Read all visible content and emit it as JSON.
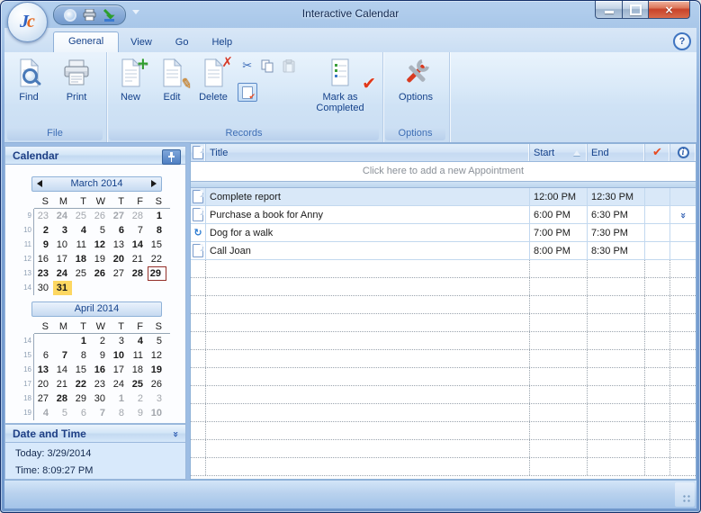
{
  "titlebar": {
    "title": "Interactive Calendar"
  },
  "tabs": [
    {
      "label": "General",
      "active": true
    },
    {
      "label": "View",
      "active": false
    },
    {
      "label": "Go",
      "active": false
    },
    {
      "label": "Help",
      "active": false
    }
  ],
  "ribbon": {
    "groups": [
      {
        "caption": "File"
      },
      {
        "caption": "Records"
      },
      {
        "caption": "Options"
      }
    ],
    "buttons": {
      "find": "Find",
      "print": "Print",
      "new": "New",
      "edit": "Edit",
      "delete": "Delete",
      "mark": "Mark as Completed",
      "options": "Options"
    }
  },
  "sidebar": {
    "calendar_header": "Calendar",
    "months": [
      {
        "label": "March 2014",
        "nav_arrows": true,
        "weekdays": [
          "S",
          "M",
          "T",
          "W",
          "T",
          "F",
          "S"
        ],
        "weeks": [
          {
            "n": "9",
            "d": [
              {
                "t": "23",
                "f": "g"
              },
              {
                "t": "24",
                "f": "g b"
              },
              {
                "t": "25",
                "f": "g"
              },
              {
                "t": "26",
                "f": "g"
              },
              {
                "t": "27",
                "f": "g b"
              },
              {
                "t": "28",
                "f": "g"
              },
              {
                "t": "1",
                "f": "b"
              }
            ]
          },
          {
            "n": "10",
            "d": [
              {
                "t": "2",
                "f": "b"
              },
              {
                "t": "3",
                "f": "b"
              },
              {
                "t": "4",
                "f": "b"
              },
              {
                "t": "5",
                "f": ""
              },
              {
                "t": "6",
                "f": "b"
              },
              {
                "t": "7",
                "f": ""
              },
              {
                "t": "8",
                "f": "b"
              }
            ]
          },
          {
            "n": "11",
            "d": [
              {
                "t": "9",
                "f": "b"
              },
              {
                "t": "10",
                "f": ""
              },
              {
                "t": "11",
                "f": ""
              },
              {
                "t": "12",
                "f": "b"
              },
              {
                "t": "13",
                "f": ""
              },
              {
                "t": "14",
                "f": "b"
              },
              {
                "t": "15",
                "f": ""
              }
            ]
          },
          {
            "n": "12",
            "d": [
              {
                "t": "16",
                "f": ""
              },
              {
                "t": "17",
                "f": ""
              },
              {
                "t": "18",
                "f": "b"
              },
              {
                "t": "19",
                "f": ""
              },
              {
                "t": "20",
                "f": "b"
              },
              {
                "t": "21",
                "f": ""
              },
              {
                "t": "22",
                "f": ""
              }
            ]
          },
          {
            "n": "13",
            "d": [
              {
                "t": "23",
                "f": "b"
              },
              {
                "t": "24",
                "f": "b"
              },
              {
                "t": "25",
                "f": ""
              },
              {
                "t": "26",
                "f": "b"
              },
              {
                "t": "27",
                "f": ""
              },
              {
                "t": "28",
                "f": "b"
              },
              {
                "t": "29",
                "f": "b today"
              }
            ]
          },
          {
            "n": "14",
            "d": [
              {
                "t": "30",
                "f": ""
              },
              {
                "t": "31",
                "f": "b hl"
              },
              {
                "t": "",
                "f": ""
              },
              {
                "t": "",
                "f": ""
              },
              {
                "t": "",
                "f": ""
              },
              {
                "t": "",
                "f": ""
              },
              {
                "t": "",
                "f": ""
              }
            ]
          }
        ]
      },
      {
        "label": "April 2014",
        "nav_arrows": false,
        "weekdays": [
          "S",
          "M",
          "T",
          "W",
          "T",
          "F",
          "S"
        ],
        "weeks": [
          {
            "n": "14",
            "d": [
              {
                "t": "",
                "f": ""
              },
              {
                "t": "",
                "f": ""
              },
              {
                "t": "1",
                "f": "b"
              },
              {
                "t": "2",
                "f": ""
              },
              {
                "t": "3",
                "f": ""
              },
              {
                "t": "4",
                "f": "b"
              },
              {
                "t": "5",
                "f": ""
              }
            ]
          },
          {
            "n": "15",
            "d": [
              {
                "t": "6",
                "f": ""
              },
              {
                "t": "7",
                "f": "b"
              },
              {
                "t": "8",
                "f": ""
              },
              {
                "t": "9",
                "f": ""
              },
              {
                "t": "10",
                "f": "b"
              },
              {
                "t": "11",
                "f": ""
              },
              {
                "t": "12",
                "f": ""
              }
            ]
          },
          {
            "n": "16",
            "d": [
              {
                "t": "13",
                "f": "b"
              },
              {
                "t": "14",
                "f": ""
              },
              {
                "t": "15",
                "f": ""
              },
              {
                "t": "16",
                "f": "b"
              },
              {
                "t": "17",
                "f": ""
              },
              {
                "t": "18",
                "f": ""
              },
              {
                "t": "19",
                "f": "b"
              }
            ]
          },
          {
            "n": "17",
            "d": [
              {
                "t": "20",
                "f": ""
              },
              {
                "t": "21",
                "f": ""
              },
              {
                "t": "22",
                "f": "b"
              },
              {
                "t": "23",
                "f": ""
              },
              {
                "t": "24",
                "f": ""
              },
              {
                "t": "25",
                "f": "b"
              },
              {
                "t": "26",
                "f": ""
              }
            ]
          },
          {
            "n": "18",
            "d": [
              {
                "t": "27",
                "f": ""
              },
              {
                "t": "28",
                "f": "b"
              },
              {
                "t": "29",
                "f": ""
              },
              {
                "t": "30",
                "f": ""
              },
              {
                "t": "1",
                "f": "g b"
              },
              {
                "t": "2",
                "f": "g"
              },
              {
                "t": "3",
                "f": "g"
              }
            ]
          },
          {
            "n": "19",
            "d": [
              {
                "t": "4",
                "f": "g b"
              },
              {
                "t": "5",
                "f": "g"
              },
              {
                "t": "6",
                "f": "g"
              },
              {
                "t": "7",
                "f": "g b"
              },
              {
                "t": "8",
                "f": "g"
              },
              {
                "t": "9",
                "f": "g"
              },
              {
                "t": "10",
                "f": "g b"
              }
            ]
          }
        ]
      }
    ],
    "date_time": {
      "header": "Date and Time",
      "today": "Today: 3/29/2014",
      "time": "Time: 8:09:27 PM"
    }
  },
  "table": {
    "columns": {
      "title": "Title",
      "start": "Start",
      "end": "End"
    },
    "add_row": "Click here to add a new Appointment",
    "rows": [
      {
        "icon": "document",
        "title": "Complete report",
        "start": "12:00 PM",
        "end": "12:30 PM",
        "selected": true,
        "expand": false
      },
      {
        "icon": "document",
        "title": "Purchase a book for Anny",
        "start": "6:00 PM",
        "end": "6:30 PM",
        "selected": false,
        "expand": true
      },
      {
        "icon": "recurrence",
        "title": "Dog for a walk",
        "start": "7:00 PM",
        "end": "7:30 PM",
        "selected": false,
        "expand": false
      },
      {
        "icon": "document",
        "title": "Call Joan",
        "start": "8:00 PM",
        "end": "8:30 PM",
        "selected": false,
        "expand": false
      }
    ],
    "empty_row_count": 12
  },
  "icons": {
    "check": "✔",
    "info": "i",
    "scissors": "✂",
    "chevron_double": "»",
    "help": "?",
    "close": "×",
    "recurrence": "↻",
    "pencil": "✎",
    "plus": "+",
    "cross": "✗"
  }
}
